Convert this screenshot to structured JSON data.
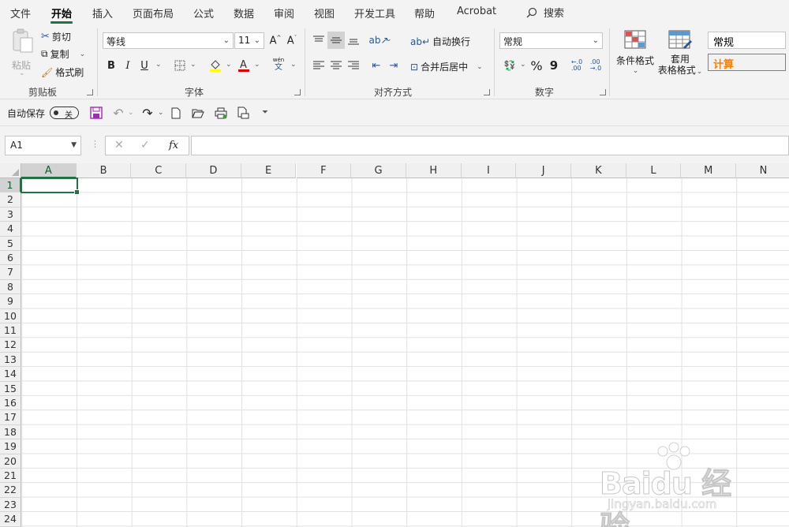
{
  "menu": {
    "tabs": [
      "文件",
      "开始",
      "插入",
      "页面布局",
      "公式",
      "数据",
      "审阅",
      "视图",
      "开发工具",
      "帮助",
      "Acrobat"
    ],
    "search_label": "搜索"
  },
  "ribbon": {
    "clipboard": {
      "paste": "粘贴",
      "cut": "剪切",
      "copy": "复制",
      "format_painter": "格式刷",
      "label": "剪贴板"
    },
    "font": {
      "name": "等线",
      "size": "11",
      "label": "字体",
      "bold": "B",
      "italic": "I",
      "underline": "U",
      "phonetic_top": "wén",
      "phonetic_bottom": "文"
    },
    "alignment": {
      "wrap": "自动换行",
      "merge": "合并后居中",
      "label": "对齐方式"
    },
    "number": {
      "format": "常规",
      "percent": "%",
      "comma": "9",
      "label": "数字"
    },
    "styles": {
      "conditional": "条件格式",
      "table_line1": "套用",
      "table_line2": "表格格式",
      "style_normal": "常规",
      "style_calc": "计算"
    }
  },
  "qat": {
    "autosave": "自动保存",
    "toggle": "关"
  },
  "formula_bar": {
    "name_box": "A1",
    "fx": "fx"
  },
  "grid": {
    "columns": [
      "A",
      "B",
      "C",
      "D",
      "E",
      "F",
      "G",
      "H",
      "I",
      "J",
      "K",
      "L",
      "M",
      "N"
    ],
    "rows": [
      "1",
      "2",
      "3",
      "4",
      "5",
      "6",
      "7",
      "8",
      "9",
      "10",
      "11",
      "12",
      "13",
      "14",
      "15",
      "16",
      "17",
      "18",
      "19",
      "20",
      "21",
      "22",
      "23",
      "24"
    ]
  },
  "watermark": {
    "brand": "Baidu 经验",
    "url": "jingyan.baidu.com"
  },
  "colors": {
    "accent": "#217346",
    "calc_text": "#fa7d00",
    "calc_bg": "#f2f2f2"
  }
}
